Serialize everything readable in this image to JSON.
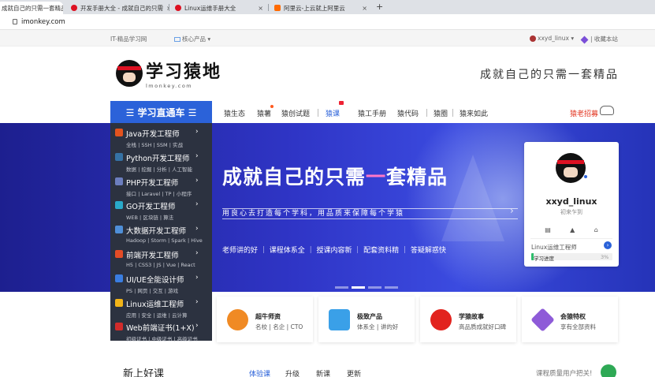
{
  "browser": {
    "tabs": [
      {
        "title": "成就自己的只需一套精品",
        "active": true,
        "close": "×",
        "color": "#d12"
      },
      {
        "title": "开发手册大全 - 成就自己的只需",
        "active": false,
        "close": "×",
        "color": "#d12"
      },
      {
        "title": "Linux运维手册大全",
        "active": false,
        "close": "×",
        "color": "#d12"
      },
      {
        "title": "阿里云-上云就上阿里云",
        "active": false,
        "close": "×",
        "color": "#ff6a00"
      }
    ],
    "new_tab": "+",
    "url": "imonkey.com"
  },
  "topbar": {
    "site": "IT-精品学习网",
    "core": "核心产品",
    "user": "xxyd_linux",
    "favorite": "收藏本站"
  },
  "header": {
    "logo_cn": "学习猿地",
    "logo_en": "lmonkey.com",
    "slogan": "成就自己的只需一套精品"
  },
  "nav": {
    "category_button": "☰ 学习直通车 ☰",
    "items": [
      "猿生态",
      "猿薯",
      "猿创试题",
      "猿课",
      "猿工手册",
      "猿代码",
      "猿圈",
      "猿来如此"
    ],
    "recruit": "猿老招募"
  },
  "menu": [
    {
      "title": "Java开发工程师",
      "sub": "全栈 | SSH | SSM | 实战",
      "icon_color": "#e2531e"
    },
    {
      "title": "Python开发工程师",
      "sub": "数据 | 挖掘 | 分析 | 人工智能",
      "icon_color": "#3572a5"
    },
    {
      "title": "PHP开发工程师",
      "sub": "接口 | Laravel | TP | 小程序",
      "icon_color": "#6c7ebf"
    },
    {
      "title": "GO开发工程师",
      "sub": "WEB | 区块链 | 算法",
      "icon_color": "#29a9c9"
    },
    {
      "title": "大数据开发工程师",
      "sub": "Hadoop | Storm | Spark | Hive",
      "icon_color": "#4f8fd8"
    },
    {
      "title": "前端开发工程师",
      "sub": "H5 | CSS3 | JS | Vue | React",
      "icon_color": "#e34c26"
    },
    {
      "title": "UI/UE全能设计师",
      "sub": "PS | 网页 | 交互 | 游戏",
      "icon_color": "#3a7de0"
    },
    {
      "title": "Linux运维工程师",
      "sub": "应用 | 安全 | 运维 | 云计算",
      "icon_color": "#f2b418"
    },
    {
      "title": "Web前端证书(1+X)",
      "sub": "初级证书 | 中级证书 | 高级证书",
      "icon_color": "#d12b2b"
    }
  ],
  "menu_arrow": "›",
  "banner": {
    "title_white1": "成就自己的只需",
    "title_pink": "一",
    "title_white2": "套精品",
    "subtitle": "用良心去打造每个学科，用品质来保障每个学猿",
    "features": "老师讲的好 ｜ 课程体系全 ｜ 授课内容新 ｜ 配套资料精 ｜ 答疑解惑快",
    "slide_count": 4,
    "active_slide": 1,
    "next_arrow": "›"
  },
  "user_card": {
    "username": "xxyd_linux",
    "tag": "初来乍到",
    "course": "Linux运维工程师",
    "go": "›",
    "progress_label": "学习进度",
    "progress_value": "3%",
    "progress": 0.03,
    "icons": [
      "note-icon",
      "bell-icon",
      "home-icon"
    ],
    "icon_glyphs": [
      "▤",
      "▲",
      "⌂"
    ]
  },
  "features": [
    {
      "title": "超牛师资",
      "sub": "名校 | 名企 | CTO",
      "icon_color": "#f08a24",
      "icon": "teacher-icon"
    },
    {
      "title": "极致产品",
      "sub": "体系全 | 讲的好",
      "icon_color": "#3aa0e8",
      "icon": "video-icon"
    },
    {
      "title": "学猿故事",
      "sub": "高品质成就好口碑",
      "icon_color": "#e2231e",
      "icon": "thumb-100-icon"
    },
    {
      "title": "会猿特权",
      "sub": "享有全部资料",
      "icon_color": "#8e5bd8",
      "icon": "diamond-icon"
    }
  ],
  "bottom": {
    "title": "新上好课",
    "tabs": [
      "体验课",
      "升级",
      "新课",
      "更新"
    ],
    "note": "课程质量用户把关!"
  }
}
